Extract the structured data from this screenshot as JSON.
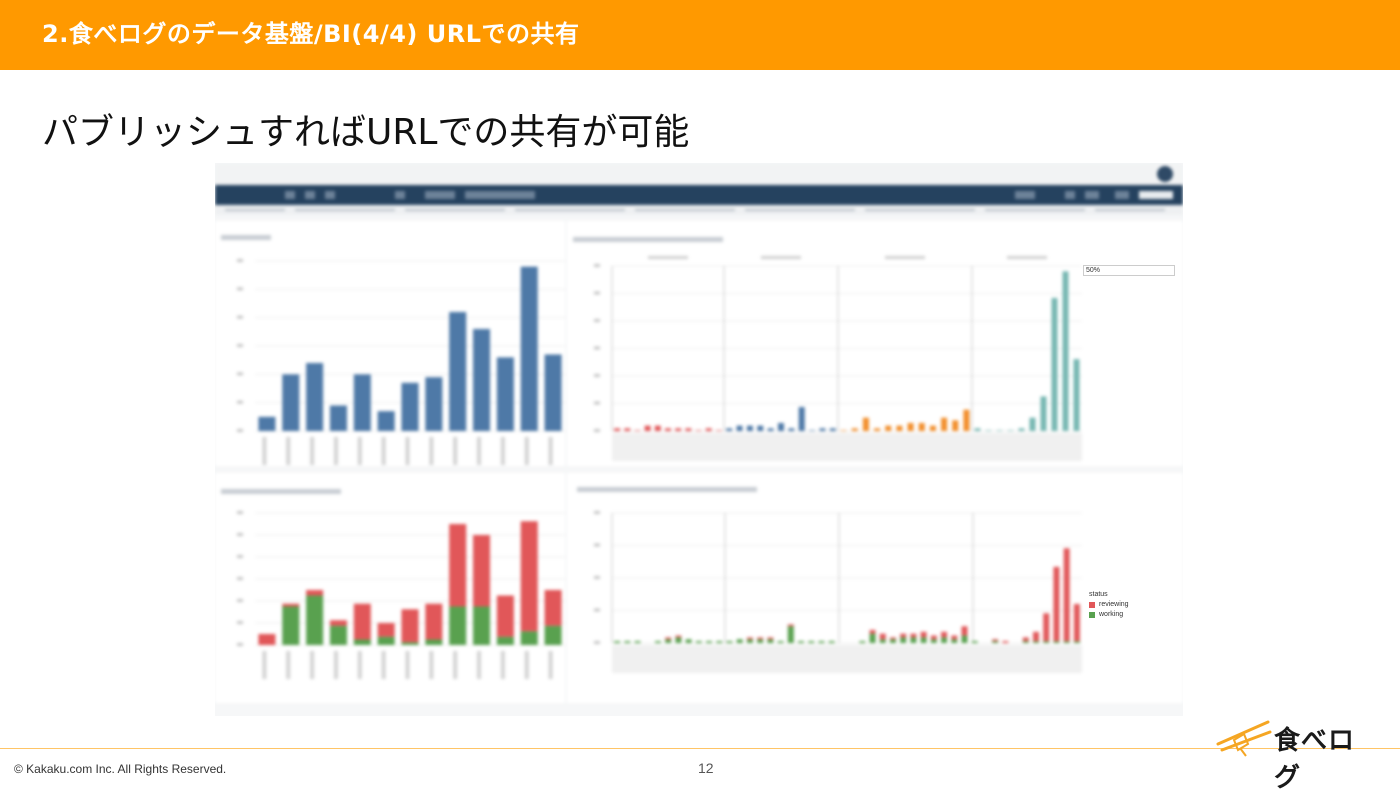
{
  "header": {
    "title": "2.食べログのデータ基盤/BI(4/4) URLでの共有",
    "color": "#ff9900"
  },
  "slide": {
    "heading": "パブリッシュすればURLでの共有が可能"
  },
  "footer": {
    "copyright": "© Kakaku.com Inc. All Rights Reserved.",
    "page_number": "12"
  },
  "logo": {
    "text": "食べログ",
    "icon": "chopsticks-icon",
    "accent": "#f5a623"
  },
  "screenshot": {
    "legend_title": "status",
    "legend_items": [
      {
        "label": "reviewing",
        "color": "#e15759"
      },
      {
        "label": "working",
        "color": "#59a14f"
      }
    ],
    "filter_value": "50%"
  },
  "chart_data": [
    {
      "type": "bar",
      "color": "#4e79a7",
      "values": [
        5,
        20,
        24,
        9,
        20,
        7,
        17,
        19,
        42,
        36,
        26,
        58,
        27
      ]
    },
    {
      "type": "bar",
      "series": [
        {
          "name": "reviewing",
          "color": "#e15759",
          "values": [
            4,
            1,
            2,
            2,
            13,
            5,
            12,
            13,
            30,
            26,
            15,
            40,
            13
          ]
        },
        {
          "name": "working",
          "color": "#59a14f",
          "values": [
            0,
            14,
            18,
            7,
            2,
            3,
            1,
            2,
            14,
            14,
            3,
            5,
            7
          ]
        }
      ]
    },
    {
      "type": "bar",
      "groups": [
        {
          "color": "#e15759",
          "values": [
            1,
            1,
            0,
            2,
            2,
            1,
            1,
            1,
            0,
            1,
            0
          ]
        },
        {
          "color": "#4e79a7",
          "values": [
            1,
            2,
            2,
            2,
            1,
            3,
            1,
            9,
            0,
            1,
            1
          ]
        },
        {
          "color": "#f28e2b",
          "values": [
            0,
            1,
            5,
            1,
            2,
            2,
            3,
            3,
            2,
            5,
            4,
            8
          ]
        },
        {
          "color": "#76b7b2",
          "values": [
            1,
            0,
            0,
            0,
            1,
            5,
            13,
            50,
            60,
            27
          ]
        }
      ]
    },
    {
      "type": "bar",
      "series": [
        {
          "name": "reviewing",
          "color": "#e15759",
          "values": [
            0,
            0,
            0,
            0,
            0,
            1,
            1,
            0,
            0,
            0,
            0,
            0,
            0,
            1,
            1,
            1,
            0,
            1,
            0,
            0,
            0,
            0,
            0,
            0,
            0,
            2,
            3,
            1,
            2,
            2,
            3,
            2,
            3,
            2,
            5,
            0,
            0,
            1,
            1,
            0,
            2,
            5,
            15,
            40,
            50,
            20
          ]
        },
        {
          "name": "working",
          "color": "#59a14f",
          "values": [
            1,
            1,
            1,
            0,
            1,
            2,
            3,
            2,
            1,
            1,
            1,
            1,
            2,
            2,
            2,
            2,
            1,
            9,
            1,
            1,
            1,
            1,
            0,
            0,
            1,
            5,
            2,
            2,
            3,
            3,
            3,
            2,
            3,
            2,
            4,
            1,
            0,
            1,
            0,
            0,
            1,
            1,
            1,
            1,
            1,
            1
          ]
        }
      ]
    }
  ]
}
